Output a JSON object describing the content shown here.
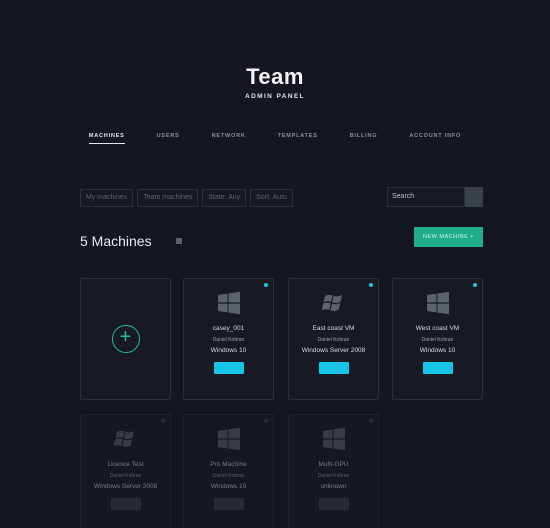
{
  "header": {
    "title": "Team",
    "subtitle": "ADMIN PANEL"
  },
  "nav": {
    "items": [
      {
        "label": "MACHINES",
        "active": true
      },
      {
        "label": "USERS",
        "active": false
      },
      {
        "label": "NETWORK",
        "active": false
      },
      {
        "label": "TEMPLATES",
        "active": false
      },
      {
        "label": "BILLING",
        "active": false
      },
      {
        "label": "ACCOUNT INFO",
        "active": false
      }
    ]
  },
  "filters": {
    "my_machines": "My machines",
    "team_machines": "Team machines",
    "state": "State: Any",
    "sort": "Sort: Auto"
  },
  "search": {
    "placeholder": "Search"
  },
  "machines_count": "5 Machines",
  "new_button_label": "NEW MACHINE +",
  "colors": {
    "accent": "#1fae88",
    "online": "#19c6e8",
    "background": "#14181e"
  },
  "machines": [
    {
      "name": "casey_001",
      "owner": "Daniel Kobran",
      "os": "Windows 10",
      "status": "online",
      "icon": "windows-10-icon"
    },
    {
      "name": "East coast VM",
      "owner": "Daniel Kobran",
      "os": "Windows Server 2008",
      "status": "online",
      "icon": "windows-flag-icon"
    },
    {
      "name": "West coast VM",
      "owner": "Daniel Kobran",
      "os": "Windows 10",
      "status": "online",
      "icon": "windows-10-icon"
    },
    {
      "name": "Licence Test",
      "owner": "Daniel Kobran",
      "os": "Windows Server 2008",
      "status": "offline",
      "icon": "windows-flag-icon"
    },
    {
      "name": "Pro Machine",
      "owner": "Daniel Kobran",
      "os": "Windows 10",
      "status": "offline",
      "icon": "windows-10-icon"
    },
    {
      "name": "Multi-GPU",
      "owner": "Daniel Kobran",
      "os": "unknown",
      "status": "offline",
      "icon": "windows-10-icon"
    }
  ]
}
